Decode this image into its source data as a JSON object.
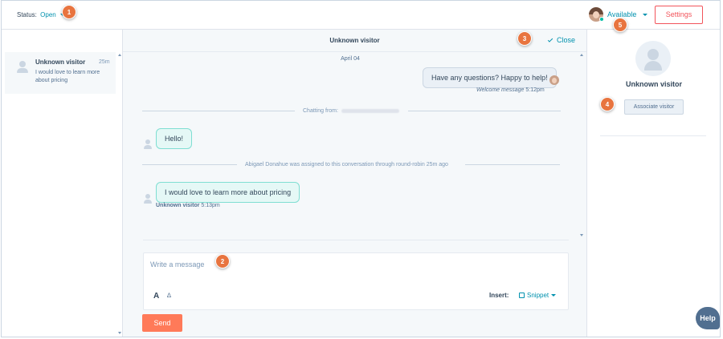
{
  "topbar": {
    "status_label": "Status:",
    "status_value": "Open",
    "availability": "Available",
    "settings_label": "Settings"
  },
  "callouts": [
    "1",
    "2",
    "3",
    "4",
    "5"
  ],
  "inbox": {
    "items": [
      {
        "name": "Unknown visitor",
        "time": "25m",
        "preview": "I would love to learn more about pricing"
      }
    ]
  },
  "chat": {
    "title": "Unknown visitor",
    "close_label": "Close",
    "date": "April 04",
    "messages": [
      {
        "from": "agent",
        "text": "Have any questions? Happy to help!",
        "meta_label": "Welcome message",
        "meta_time": "5:12pm"
      },
      {
        "from": "visitor",
        "text": "Hello!"
      },
      {
        "from": "visitor",
        "text": "I would love to learn more about pricing",
        "meta_label": "Unknown visitor",
        "meta_time": "5:13pm"
      }
    ],
    "chatting_from": "Chatting from:",
    "assignment_note": "Abigael Donahue was assigned to this conversation through round-robin 25m ago"
  },
  "composer": {
    "placeholder": "Write a message",
    "format_label": "A",
    "insert_label": "Insert:",
    "snippet_label": "Snippet",
    "send_label": "Send"
  },
  "contact": {
    "name": "Unknown visitor",
    "associate_label": "Associate visitor"
  },
  "help_label": "Help",
  "colors": {
    "accent": "#0091ae",
    "send": "#ff7a59",
    "callout": "#e8743f",
    "settings": "#f2545b",
    "online": "#00bda5"
  },
  "icons": [
    "person-icon",
    "chevron-down-icon",
    "check-icon",
    "link-icon",
    "snippet-icon",
    "scroll-arrow-icon"
  ]
}
